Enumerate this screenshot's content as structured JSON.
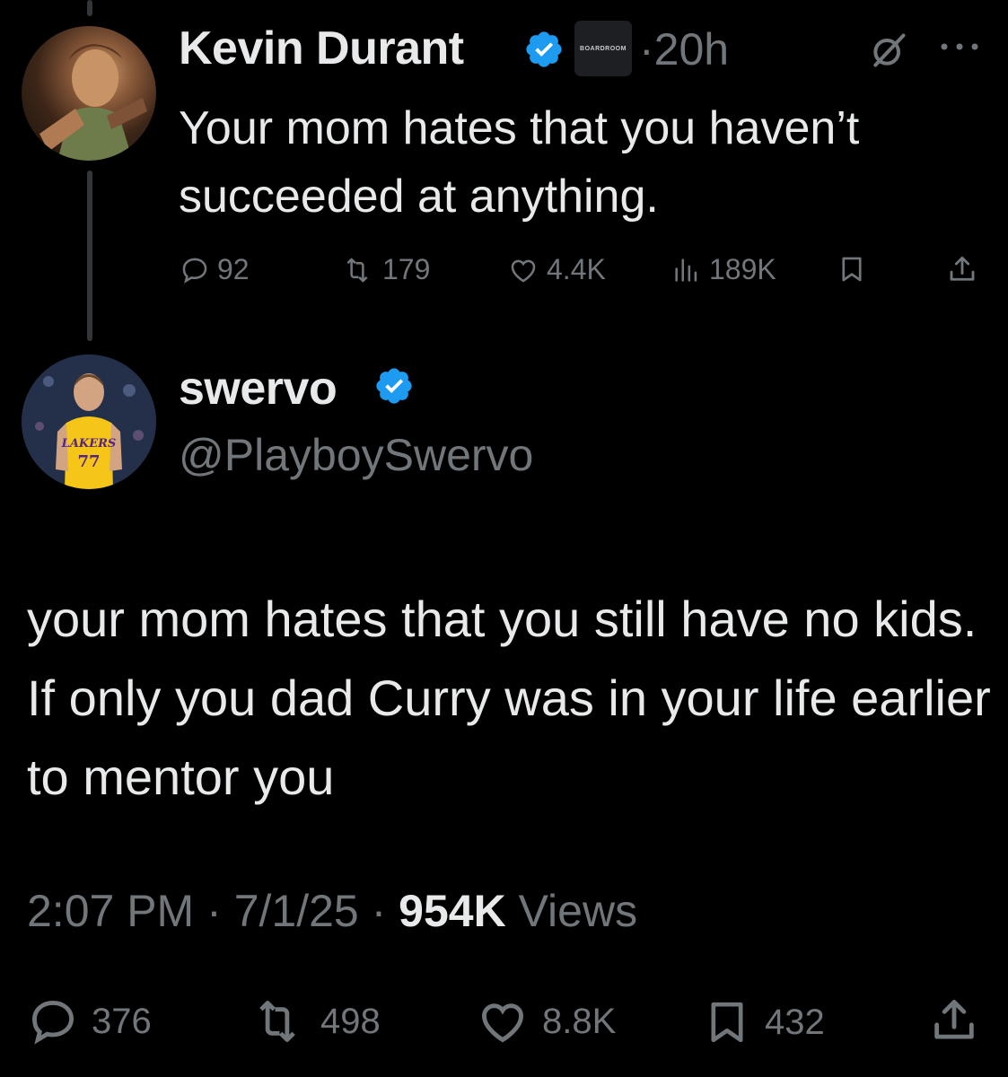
{
  "reply_to": {
    "display_name": "Kevin Durant",
    "affiliate_badge": "BOARDROOM",
    "separator": "·",
    "time_ago": "20h",
    "text": "Your mom hates that you haven’t succeeded at anything.",
    "stats": {
      "replies": "92",
      "reposts": "179",
      "likes": "4.4K",
      "views": "189K"
    }
  },
  "tweet": {
    "display_name": "swervo",
    "handle": "@PlayboySwervo",
    "text": "your mom hates that you still have no kids. If only you dad Curry was in your life earlier to mentor you",
    "time": "2:07 PM",
    "date": "7/1/25",
    "dot": "·",
    "views_count": "954K",
    "views_label": "Views",
    "stats": {
      "replies": "376",
      "reposts": "498",
      "likes": "8.8K",
      "bookmarks": "432"
    }
  },
  "colors": {
    "background": "#000000",
    "text_primary": "#e7e9ea",
    "text_secondary": "#71767b",
    "verified_blue": "#1d9bf0"
  },
  "icons": [
    "verified-badge-icon",
    "grok-icon",
    "more-icon",
    "reply-icon",
    "repost-icon",
    "like-icon",
    "views-icon",
    "bookmark-icon",
    "share-icon"
  ]
}
